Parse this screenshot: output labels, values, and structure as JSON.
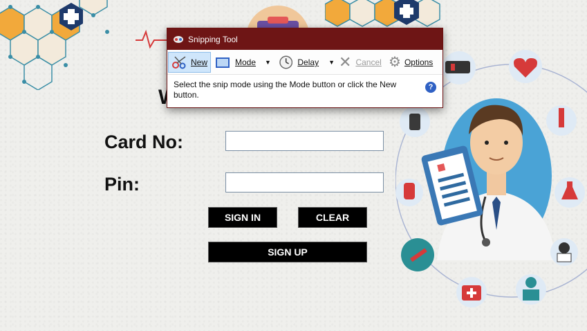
{
  "snipping_tool": {
    "title": "Snipping Tool",
    "toolbar": {
      "new_label": "New",
      "mode_label": "Mode",
      "delay_label": "Delay",
      "cancel_label": "Cancel",
      "options_label": "Options"
    },
    "message": "Select the snip mode using the Mode button or click the New button.",
    "help_glyph": "?"
  },
  "login": {
    "heading_fragment": "W",
    "card_label": "Card No:",
    "pin_label": "Pin:",
    "card_value": "",
    "pin_value": "",
    "sign_in_label": "SIGN IN",
    "clear_label": "CLEAR",
    "sign_up_label": "SIGN UP"
  },
  "colors": {
    "snip_title_bar": "#6e1515",
    "button_bg": "#000000",
    "hex_yellow": "#f2a93b",
    "hex_navy": "#1e3a6b",
    "circle_blue": "#4aa3d6"
  },
  "icons": [
    "medical-cross-hexagon-icon",
    "heartbeat-icon",
    "ambulance-icon",
    "heart-icon",
    "syringe-icon",
    "medicine-bottle-icon",
    "blood-bag-icon",
    "flask-icon",
    "nurse-icon",
    "first-aid-kit-icon",
    "doctor-avatar-icon",
    "scissors-icon",
    "clock-icon",
    "gear-icon",
    "close-x-icon",
    "dropdown-arrow-icon"
  ]
}
